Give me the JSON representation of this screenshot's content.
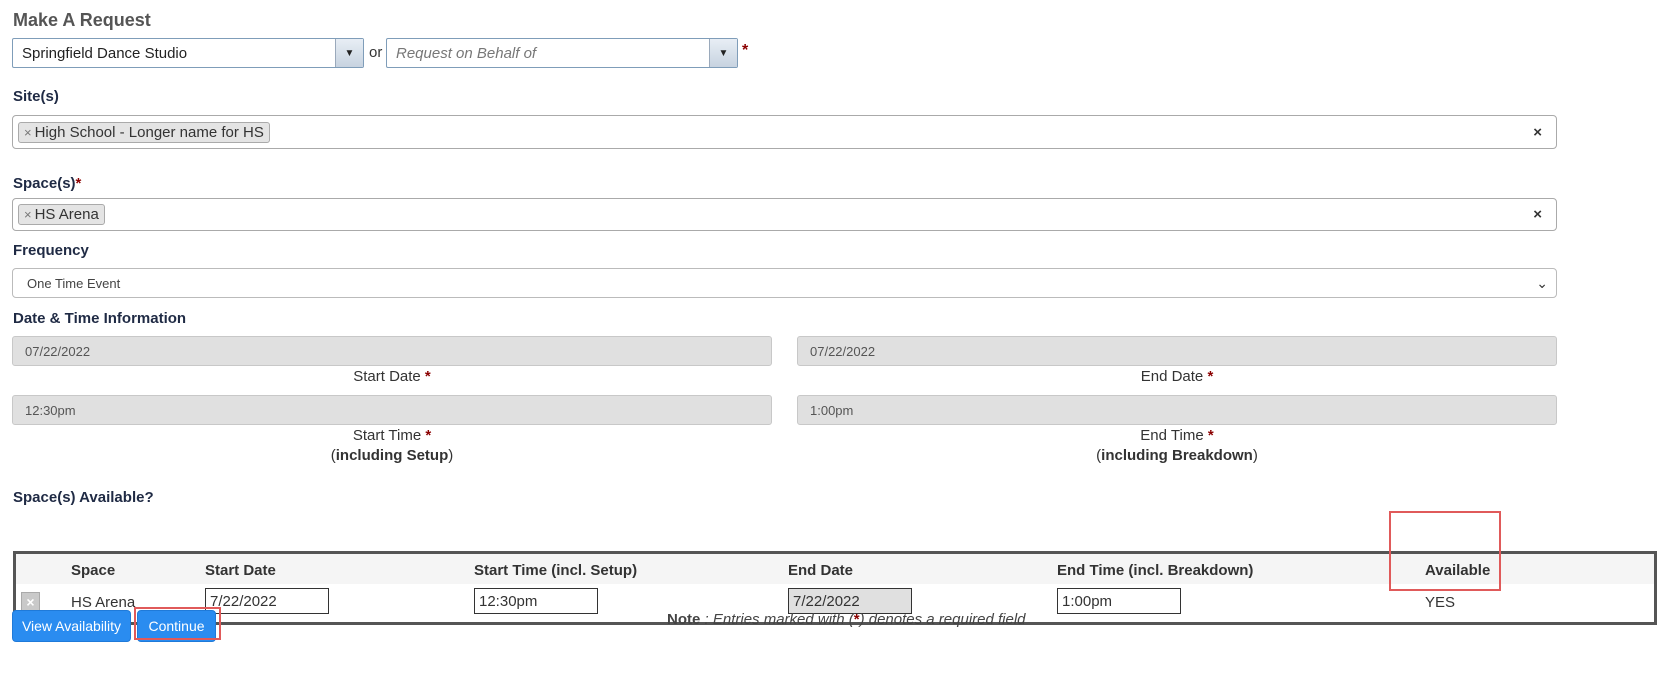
{
  "title": "Make A Request",
  "organization": {
    "value": "Springfield Dance Studio"
  },
  "or_text": "or",
  "behalf": {
    "placeholder": "Request on Behalf of"
  },
  "required_mark": "*",
  "sites": {
    "label": "Site(s)",
    "chip": "High School - Longer name for HS",
    "chip_remove": "×",
    "clear": "×"
  },
  "spaces": {
    "label": "Space(s)",
    "chip": "HS Arena",
    "chip_remove": "×",
    "clear": "×"
  },
  "frequency": {
    "label": "Frequency",
    "value": "One Time Event"
  },
  "datetime": {
    "label": "Date & Time Information",
    "start_date": "07/22/2022",
    "end_date": "07/22/2022",
    "start_time": "12:30pm",
    "end_time": "1:00pm",
    "start_date_label": "Start Date",
    "end_date_label": "End Date",
    "start_time_label": "Start Time",
    "end_time_label": "End Time",
    "start_time_sub_bold": "including Setup",
    "end_time_sub_bold": "including Breakdown",
    "paren_open": "(",
    "paren_close": ")"
  },
  "availability": {
    "label": "Space(s) Available?",
    "columns": [
      "Space",
      "Start Date",
      "Start Time (incl. Setup)",
      "End Date",
      "End Time (incl. Breakdown)",
      "Available"
    ],
    "row": {
      "space": "HS Arena",
      "start_date": "7/22/2022",
      "start_time": "12:30pm",
      "end_date": "7/22/2022",
      "end_time": "1:00pm",
      "available": "YES",
      "remove": "×"
    }
  },
  "buttons": {
    "view_availability": "View Availability",
    "continue": "Continue"
  },
  "note": {
    "label": "Note",
    "text_before": " : Entries marked with (",
    "text_after": ") denotes a required field",
    "mark": "*"
  }
}
